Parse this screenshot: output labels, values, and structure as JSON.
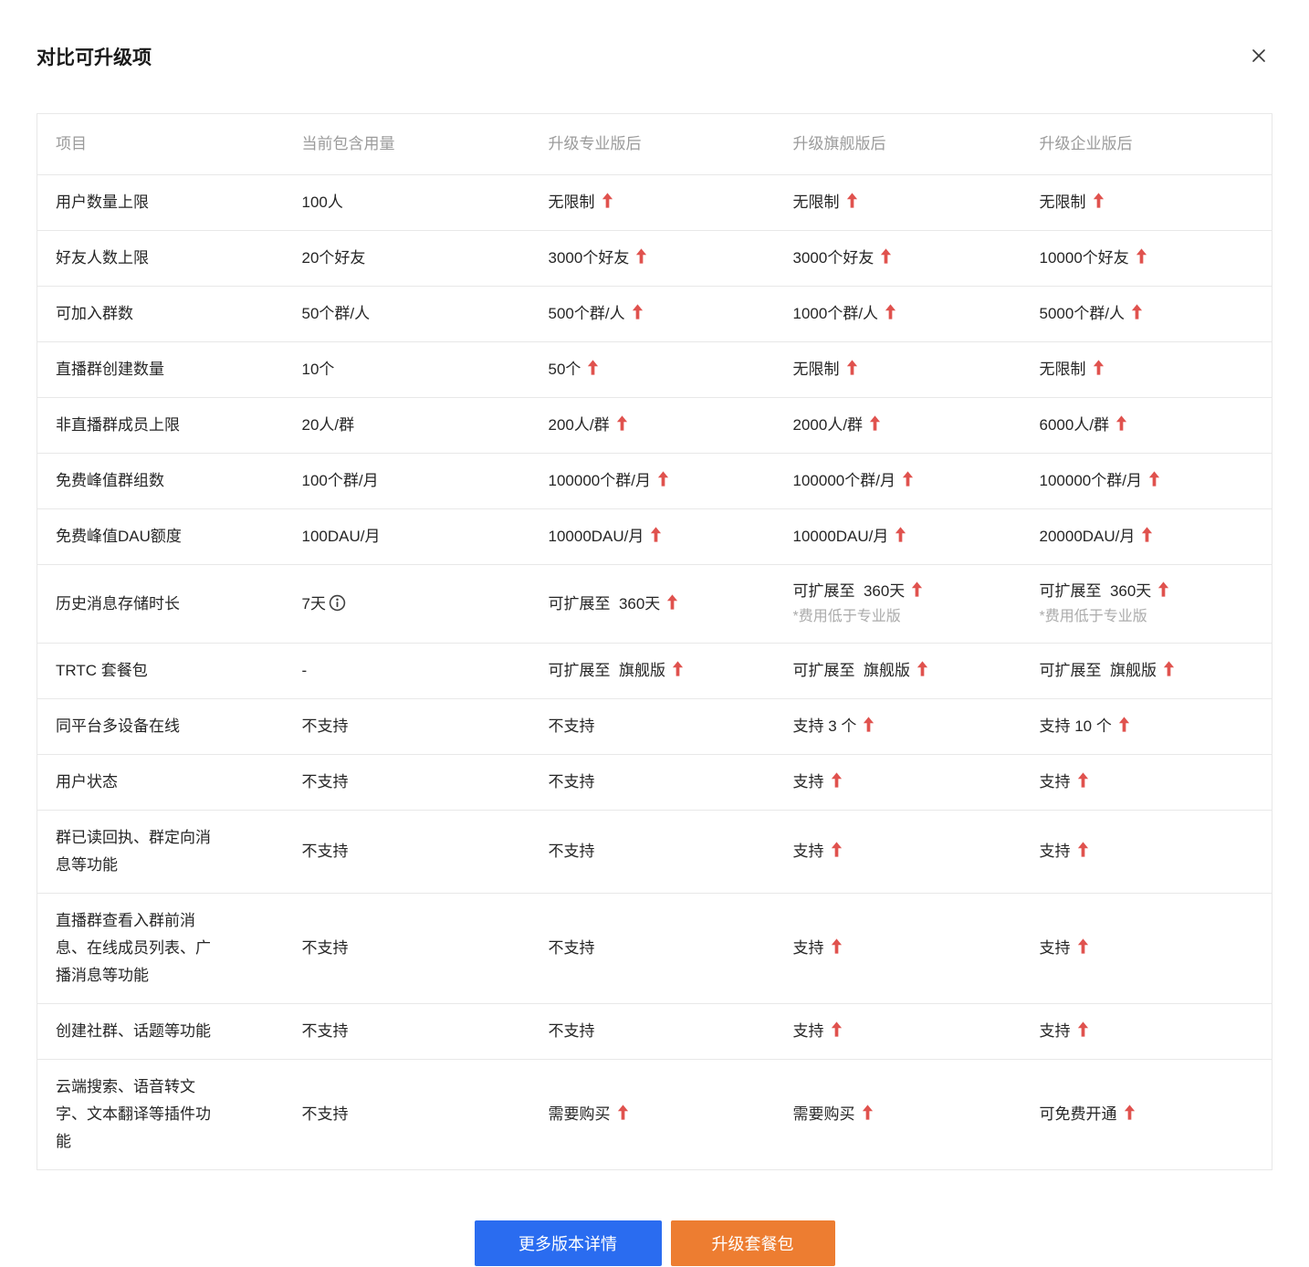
{
  "modal": {
    "title": "对比可升级项"
  },
  "icons": {
    "close": "x-mark",
    "upgrade": "up-arrow",
    "info": "info-circle"
  },
  "colors": {
    "arrow_red": "#e0524e",
    "primary_blue": "#2a6cf0",
    "upgrade_orange": "#ed7d31",
    "header_gray": "#9b9b9b",
    "note_gray": "#ababab",
    "border_gray": "#e8e8e8"
  },
  "table": {
    "headers": [
      "项目",
      "当前包含用量",
      "升级专业版后",
      "升级旗舰版后",
      "升级企业版后"
    ],
    "rows": [
      {
        "label": "用户数量上限",
        "cells": [
          {
            "text": "100人"
          },
          {
            "text": "无限制",
            "arrow": true
          },
          {
            "text": "无限制",
            "arrow": true
          },
          {
            "text": "无限制",
            "arrow": true
          }
        ]
      },
      {
        "label": "好友人数上限",
        "cells": [
          {
            "text": "20个好友"
          },
          {
            "text": "3000个好友",
            "arrow": true
          },
          {
            "text": "3000个好友",
            "arrow": true
          },
          {
            "text": "10000个好友",
            "arrow": true
          }
        ]
      },
      {
        "label": "可加入群数",
        "cells": [
          {
            "text": "50个群/人"
          },
          {
            "text": "500个群/人",
            "arrow": true
          },
          {
            "text": "1000个群/人",
            "arrow": true
          },
          {
            "text": "5000个群/人",
            "arrow": true
          }
        ]
      },
      {
        "label": "直播群创建数量",
        "cells": [
          {
            "text": "10个"
          },
          {
            "text": "50个",
            "arrow": true
          },
          {
            "text": "无限制",
            "arrow": true
          },
          {
            "text": "无限制",
            "arrow": true
          }
        ]
      },
      {
        "label": "非直播群成员上限",
        "cells": [
          {
            "text": "20人/群"
          },
          {
            "text": "200人/群",
            "arrow": true
          },
          {
            "text": "2000人/群",
            "arrow": true
          },
          {
            "text": "6000人/群",
            "arrow": true
          }
        ]
      },
      {
        "label": "免费峰值群组数",
        "cells": [
          {
            "text": "100个群/月"
          },
          {
            "text": "100000个群/月",
            "arrow": true
          },
          {
            "text": "100000个群/月",
            "arrow": true
          },
          {
            "text": "100000个群/月",
            "arrow": true
          }
        ]
      },
      {
        "label": "免费峰值DAU额度",
        "cells": [
          {
            "text": "100DAU/月"
          },
          {
            "text": "10000DAU/月",
            "arrow": true
          },
          {
            "text": "10000DAU/月",
            "arrow": true
          },
          {
            "text": "20000DAU/月",
            "arrow": true
          }
        ]
      },
      {
        "label": "历史消息存储时长",
        "cells": [
          {
            "text": "7天",
            "info": true
          },
          {
            "text": "可扩展至  360天",
            "arrow": true
          },
          {
            "text": "可扩展至  360天",
            "arrow": true,
            "note": "*费用低于专业版"
          },
          {
            "text": "可扩展至  360天",
            "arrow": true,
            "note": "*费用低于专业版"
          }
        ]
      },
      {
        "label": "TRTC 套餐包",
        "cells": [
          {
            "text": "-"
          },
          {
            "text": "可扩展至  旗舰版",
            "arrow": true
          },
          {
            "text": "可扩展至  旗舰版",
            "arrow": true
          },
          {
            "text": "可扩展至  旗舰版",
            "arrow": true
          }
        ]
      },
      {
        "label": "同平台多设备在线",
        "cells": [
          {
            "text": "不支持"
          },
          {
            "text": "不支持"
          },
          {
            "text": "支持 3 个",
            "arrow": true
          },
          {
            "text": "支持 10 个",
            "arrow": true
          }
        ]
      },
      {
        "label": "用户状态",
        "cells": [
          {
            "text": "不支持"
          },
          {
            "text": "不支持"
          },
          {
            "text": "支持",
            "arrow": true
          },
          {
            "text": "支持",
            "arrow": true
          }
        ]
      },
      {
        "label": "群已读回执、群定向消\n息等功能",
        "cells": [
          {
            "text": "不支持"
          },
          {
            "text": "不支持"
          },
          {
            "text": "支持",
            "arrow": true
          },
          {
            "text": "支持",
            "arrow": true
          }
        ]
      },
      {
        "label": "直播群查看入群前消\n息、在线成员列表、广\n播消息等功能",
        "cells": [
          {
            "text": "不支持"
          },
          {
            "text": "不支持"
          },
          {
            "text": "支持",
            "arrow": true
          },
          {
            "text": "支持",
            "arrow": true
          }
        ]
      },
      {
        "label": "创建社群、话题等功能",
        "cells": [
          {
            "text": "不支持"
          },
          {
            "text": "不支持"
          },
          {
            "text": "支持",
            "arrow": true
          },
          {
            "text": "支持",
            "arrow": true
          }
        ]
      },
      {
        "label": "云端搜索、语音转文\n字、文本翻译等插件功\n能",
        "cells": [
          {
            "text": "不支持"
          },
          {
            "text": "需要购买",
            "arrow": true
          },
          {
            "text": "需要购买",
            "arrow": true
          },
          {
            "text": "可免费开通",
            "arrow": true
          }
        ]
      }
    ]
  },
  "footer": {
    "buttons": [
      {
        "label": "更多版本详情"
      },
      {
        "label": "升级套餐包"
      }
    ]
  }
}
